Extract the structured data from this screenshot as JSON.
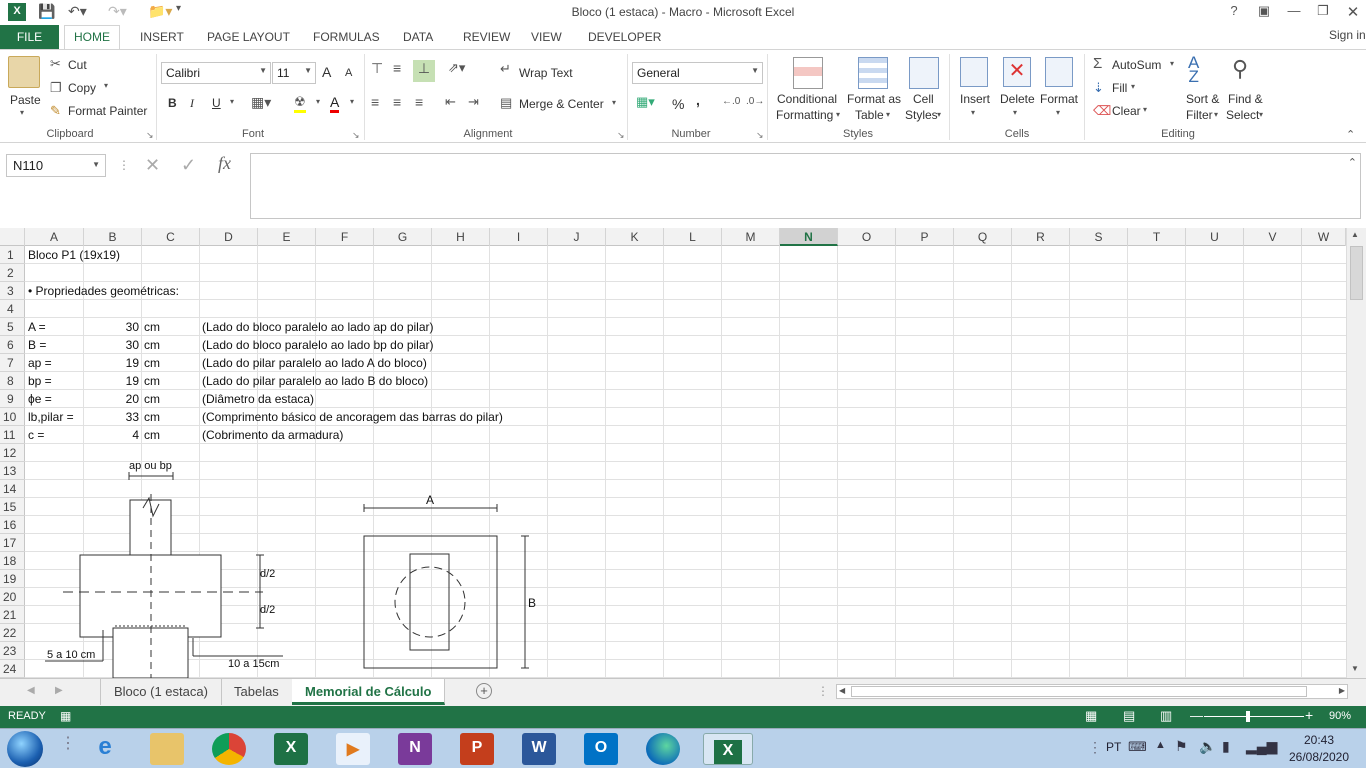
{
  "window": {
    "title": "Bloco (1 estaca) - Macro - Microsoft Excel",
    "help": "?",
    "signin": "Sign in"
  },
  "tabs": [
    "FILE",
    "HOME",
    "INSERT",
    "PAGE LAYOUT",
    "FORMULAS",
    "DATA",
    "REVIEW",
    "VIEW",
    "DEVELOPER"
  ],
  "ribbon": {
    "clipboard": {
      "paste": "Paste",
      "cut": "Cut",
      "copy": "Copy",
      "format_painter": "Format Painter",
      "label": "Clipboard"
    },
    "font": {
      "name": "Calibri",
      "size": "11",
      "label": "Font",
      "bold": "B",
      "italic": "I",
      "underline": "U",
      "grow": "A",
      "shrink": "A",
      "fontcolor": "A"
    },
    "alignment": {
      "wrap": "Wrap Text",
      "merge": "Merge & Center",
      "label": "Alignment"
    },
    "number": {
      "format": "General",
      "label": "Number",
      "percent": "%",
      "comma": ","
    },
    "styles": {
      "conditional": "Conditional",
      "conditional2": "Formatting",
      "format_table": "Format as",
      "format_table2": "Table",
      "cell_styles": "Cell",
      "cell_styles2": "Styles",
      "label": "Styles"
    },
    "cells": {
      "insert": "Insert",
      "delete": "Delete",
      "format": "Format",
      "label": "Cells"
    },
    "editing": {
      "autosum": "AutoSum",
      "fill": "Fill",
      "clear": "Clear",
      "sort": "Sort &",
      "sort2": "Filter",
      "find": "Find &",
      "find2": "Select",
      "label": "Editing"
    }
  },
  "formula_bar": {
    "namebox": "N110",
    "fx": "fx",
    "value": ""
  },
  "columns": [
    "A",
    "B",
    "C",
    "D",
    "E",
    "F",
    "G",
    "H",
    "I",
    "J",
    "K",
    "L",
    "M",
    "N",
    "O",
    "P",
    "Q",
    "R",
    "S",
    "T",
    "U",
    "V",
    "W"
  ],
  "selected_column": "N",
  "rows": [
    "1",
    "2",
    "3",
    "4",
    "5",
    "6",
    "7",
    "8",
    "9",
    "10",
    "11",
    "12",
    "13",
    "14",
    "15",
    "16",
    "17",
    "18",
    "19",
    "20",
    "21",
    "22",
    "23",
    "24"
  ],
  "cells": {
    "r1": "Bloco P1 (19x19)",
    "r3": "• Propriedades geométricas:",
    "props": [
      {
        "label": "A =",
        "value": "30",
        "unit": "cm",
        "desc": "(Lado do bloco paralelo ao lado ap do pilar)"
      },
      {
        "label": "B =",
        "value": "30",
        "unit": "cm",
        "desc": "(Lado do bloco paralelo ao lado bp do pilar)"
      },
      {
        "label": "ap =",
        "value": "19",
        "unit": "cm",
        "desc": "(Lado do pilar paralelo ao lado A do bloco)"
      },
      {
        "label": "bp =",
        "value": "19",
        "unit": "cm",
        "desc": "(Lado do pilar paralelo ao lado B do bloco)"
      },
      {
        "label": "ϕe =",
        "value": "20",
        "unit": "cm",
        "desc": "(Diâmetro da estaca)"
      },
      {
        "label": "lb,pilar =",
        "value": "33",
        "unit": "cm",
        "desc": "(Comprimento básico de ancoragem das barras do pilar)"
      },
      {
        "label": "c =",
        "value": "4",
        "unit": "cm",
        "desc": "(Cobrimento da armadura)"
      }
    ]
  },
  "drawing": {
    "ap_bp": "ap ou bp",
    "d2a": "d/2",
    "d2b": "d/2",
    "left_dim": "5 a 10 cm",
    "right_dim": "10 a 15cm",
    "A": "A",
    "B": "B"
  },
  "sheets": [
    "Bloco (1 estaca)",
    "Tabelas",
    "Memorial de Cálculo"
  ],
  "active_sheet": "Memorial de Cálculo",
  "status": {
    "ready": "READY",
    "zoom": "90%"
  },
  "taskbar": {
    "lang": "PT",
    "time": "20:43",
    "date": "26/08/2020"
  }
}
